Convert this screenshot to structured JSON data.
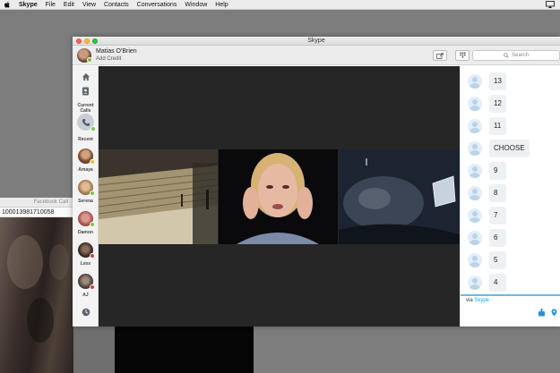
{
  "menubar": {
    "app": "Skype",
    "items": [
      "File",
      "Edit",
      "View",
      "Contacts",
      "Conversations",
      "Window",
      "Help"
    ]
  },
  "facebook_window": {
    "title": "Facebook Call",
    "caller_id": "100013981710058"
  },
  "skype": {
    "window_title": "Skype",
    "user": {
      "name": "Matias O'Brien",
      "subtitle": "Add Credit",
      "status": "online"
    },
    "search_placeholder": "Search",
    "sidebar": {
      "current_calls_label": "Current Calls",
      "recent_label": "Recent",
      "contacts": [
        {
          "name": "Amaya",
          "status": "away",
          "color": "#9b6a4b"
        },
        {
          "name": "Serena",
          "status": "online",
          "color": "#b8906a"
        },
        {
          "name": "Damon",
          "status": "online",
          "color": "#a9655e"
        },
        {
          "name": "Lexx",
          "status": "busy",
          "color": "#4a3830"
        },
        {
          "name": "AJ",
          "status": "busy",
          "color": "#5d5049"
        }
      ]
    },
    "chat": {
      "messages": [
        "13",
        "12",
        "11",
        "CHOOSE",
        "9",
        "8",
        "7",
        "6",
        "5",
        "4"
      ],
      "footer_via": "via",
      "footer_service": "Skype"
    }
  },
  "colors": {
    "skype_blue": "#00aff0",
    "online": "#7dc242",
    "busy": "#e0353b",
    "away": "#e6c31e"
  }
}
